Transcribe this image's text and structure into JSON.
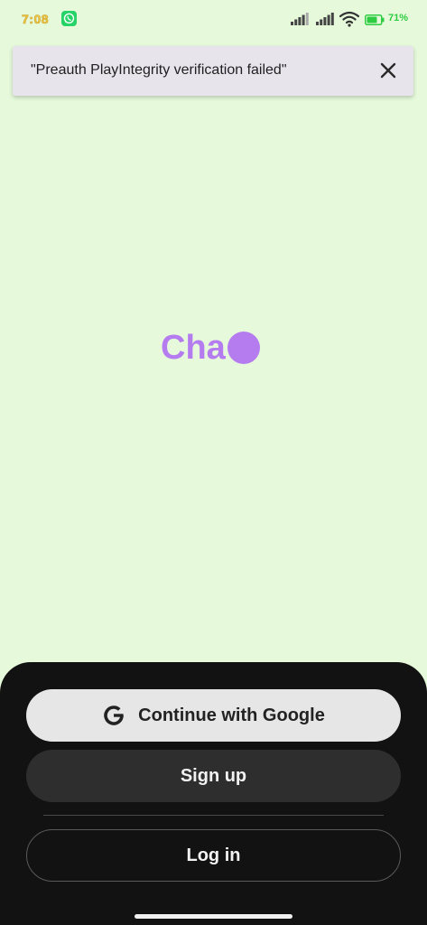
{
  "status_bar": {
    "time": "7:08",
    "battery_percent": "71%",
    "icons": [
      "whatsapp-icon",
      "signal-icon",
      "signal-icon",
      "wifi-icon",
      "battery-icon"
    ]
  },
  "toast": {
    "message": "\"Preauth PlayIntegrity verification failed\"",
    "close_icon": "close-icon"
  },
  "logo": {
    "text": "Cha"
  },
  "auth": {
    "google_label": "Continue with Google",
    "signup_label": "Sign up",
    "login_label": "Log in"
  },
  "colors": {
    "background": "#e6fadb",
    "brand_purple": "#b57cf0",
    "sheet": "#121212",
    "toast": "#e8e4ec"
  }
}
